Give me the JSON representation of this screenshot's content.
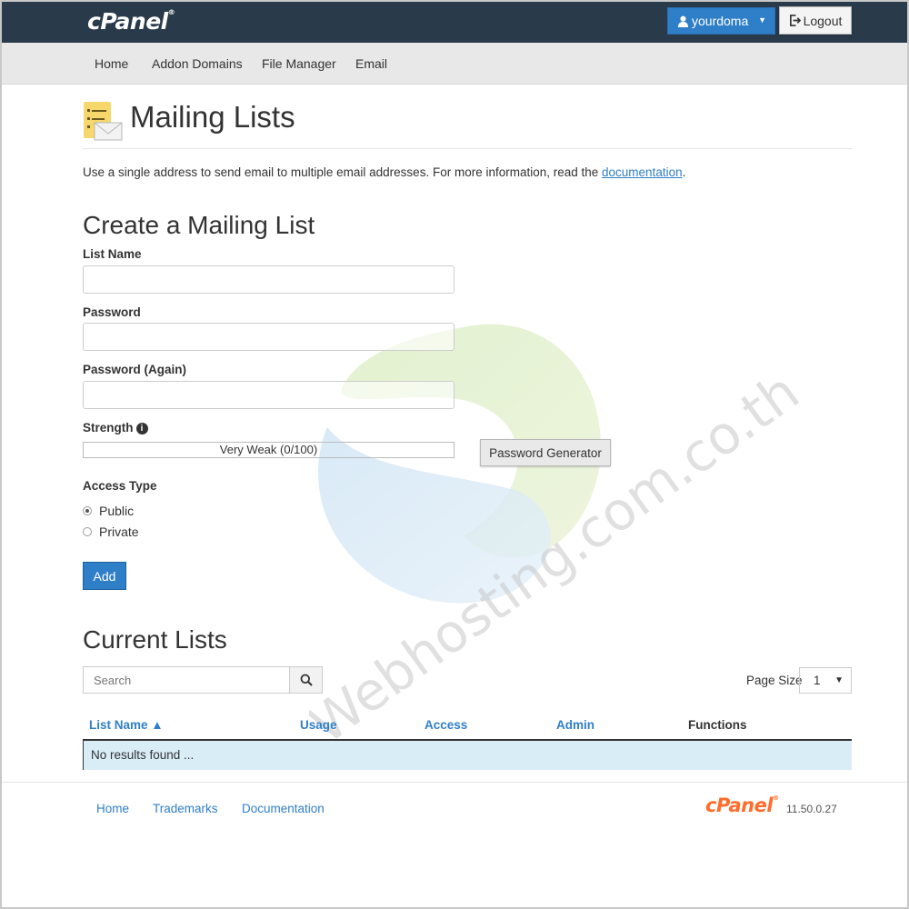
{
  "topbar": {
    "logo": "cPanel",
    "user_label": "yourdoma",
    "logout_label": "Logout"
  },
  "nav": {
    "items": [
      "Home",
      "Addon Domains",
      "File Manager",
      "Email"
    ]
  },
  "header": {
    "title": "Mailing Lists",
    "description_prefix": "Use a single address to send email to multiple email addresses. For more information, read the ",
    "description_link": "documentation",
    "description_suffix": "."
  },
  "create": {
    "title": "Create a Mailing List",
    "list_name_label": "List Name",
    "password_label": "Password",
    "password_again_label": "Password (Again)",
    "strength_label": "Strength",
    "strength_value": "Very Weak (0/100)",
    "password_generator_label": "Password Generator",
    "access_type_label": "Access Type",
    "access_options": [
      "Public",
      "Private"
    ],
    "access_selected": "Public",
    "add_label": "Add"
  },
  "current": {
    "title": "Current Lists",
    "search_placeholder": "Search",
    "page_size_label": "Page Size",
    "page_size_value": "1",
    "columns": [
      "List Name ▲",
      "Usage",
      "Access",
      "Admin",
      "Functions"
    ],
    "empty_message": "No results found ..."
  },
  "footer": {
    "links": [
      "Home",
      "Trademarks",
      "Documentation"
    ],
    "logo": "cPanel",
    "version": "11.50.0.27"
  },
  "watermark": {
    "text": "Webhosting.com.co.th"
  },
  "colors": {
    "topbar": "#293a4a",
    "accent": "#2f7fc8",
    "footer_logo": "#ff6c2c",
    "empty_row": "#d9edf7"
  }
}
